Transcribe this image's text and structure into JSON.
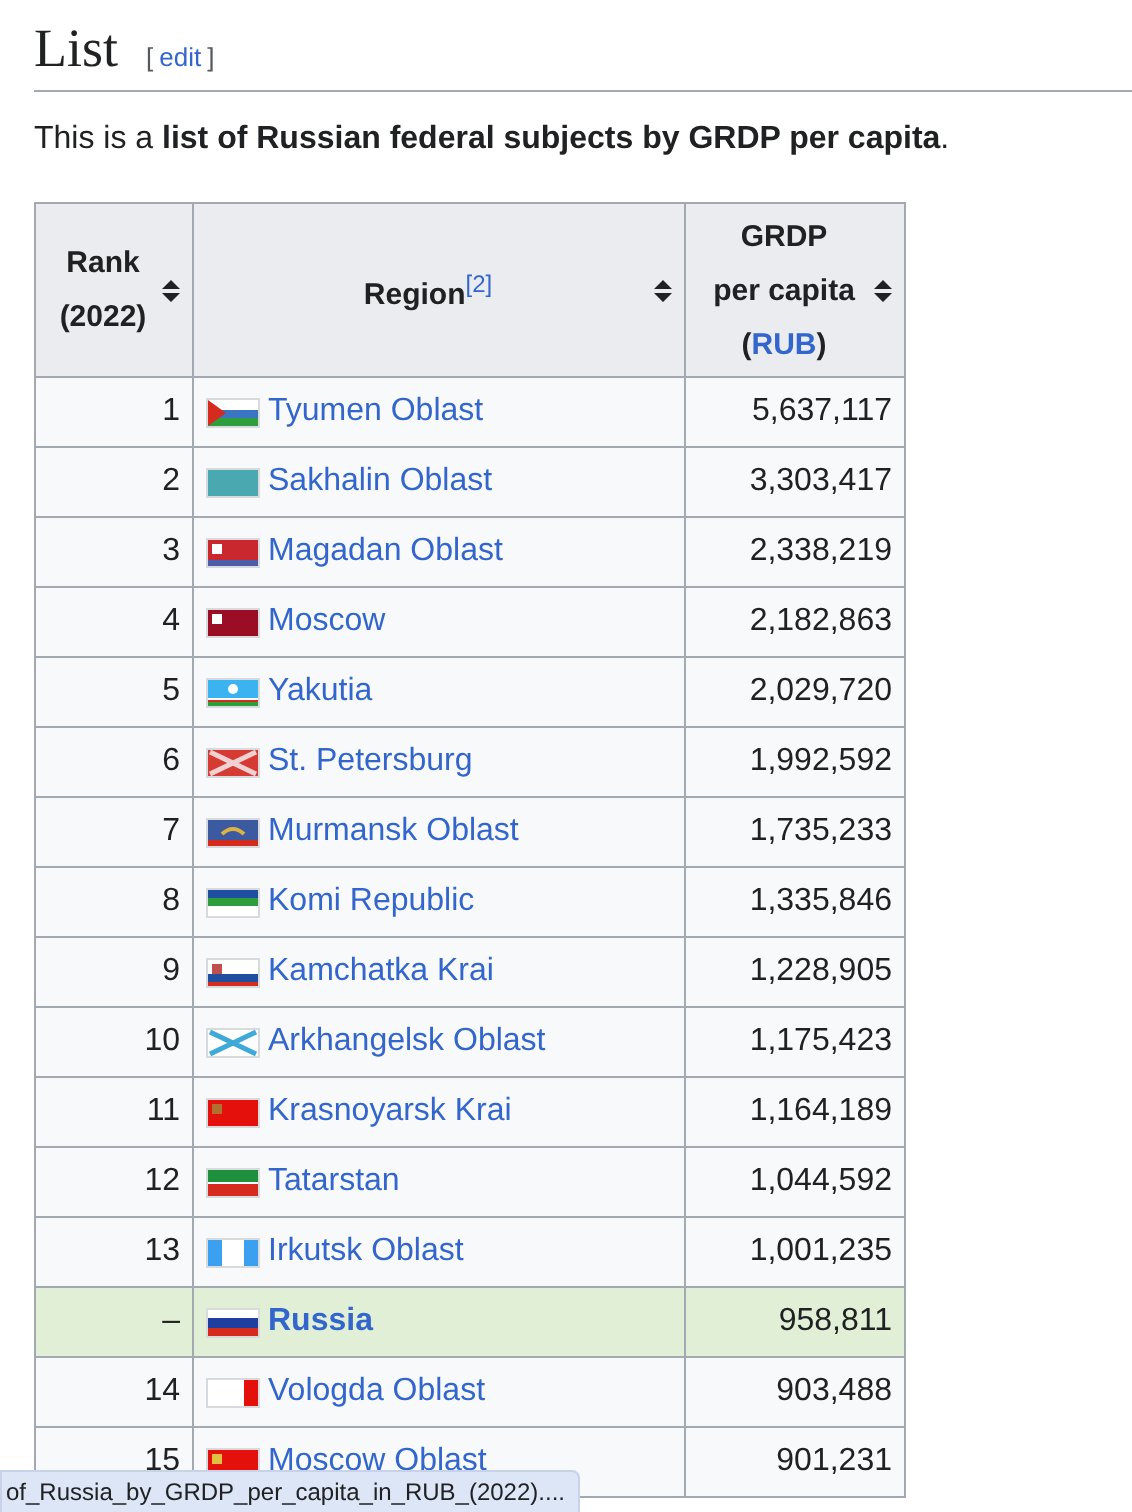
{
  "heading": {
    "title": "List",
    "edit_open": "[",
    "edit_link": "edit",
    "edit_close": "]"
  },
  "intro": "This is a **list of Russian federal subjects by GRDP per capita**.",
  "table": {
    "columns": [
      {
        "label": "Rank (2022)"
      },
      {
        "label": "Region$^{[2]}$"
      },
      {
        "label": "GRDP\nper capita",
        "unit_open": "(",
        "unit_link": "RUB",
        "unit_close": ")"
      }
    ],
    "rows": [
      {
        "rank": "1",
        "region": "Tyumen Oblast",
        "value": "5,637,117",
        "highlighted": false
      },
      {
        "rank": "2",
        "region": "Sakhalin Oblast",
        "value": "3,303,417",
        "highlighted": false
      },
      {
        "rank": "3",
        "region": "Magadan Oblast",
        "value": "2,338,219",
        "highlighted": false
      },
      {
        "rank": "4",
        "region": "Moscow",
        "value": "2,182,863",
        "highlighted": false
      },
      {
        "rank": "5",
        "region": "Yakutia",
        "value": "2,029,720",
        "highlighted": false
      },
      {
        "rank": "6",
        "region": "St. Petersburg",
        "value": "1,992,592",
        "highlighted": false
      },
      {
        "rank": "7",
        "region": "Murmansk Oblast",
        "value": "1,735,233",
        "highlighted": false
      },
      {
        "rank": "8",
        "region": "Komi Republic",
        "value": "1,335,846",
        "highlighted": false
      },
      {
        "rank": "9",
        "region": "Kamchatka Krai",
        "value": "1,228,905",
        "highlighted": false
      },
      {
        "rank": "10",
        "region": "Arkhangelsk Oblast",
        "value": "1,175,423",
        "highlighted": false
      },
      {
        "rank": "11",
        "region": "Krasnoyarsk Krai",
        "value": "1,164,189",
        "highlighted": false
      },
      {
        "rank": "12",
        "region": "Tatarstan",
        "value": "1,044,592",
        "highlighted": false
      },
      {
        "rank": "13",
        "region": "Irkutsk Oblast",
        "value": "1,001,235",
        "highlighted": false
      },
      {
        "rank": "–",
        "region": "Russia",
        "value": "958,811",
        "highlighted": true
      },
      {
        "rank": "14",
        "region": "Vologda Oblast",
        "value": "903,488",
        "highlighted": false
      },
      {
        "rank": "15",
        "region": "Moscow Oblast",
        "value": "901,231",
        "highlighted": false
      }
    ]
  },
  "status_link": "of_Russia_by_GRDP_per_capita_in_RUB_(2022)...."
}
